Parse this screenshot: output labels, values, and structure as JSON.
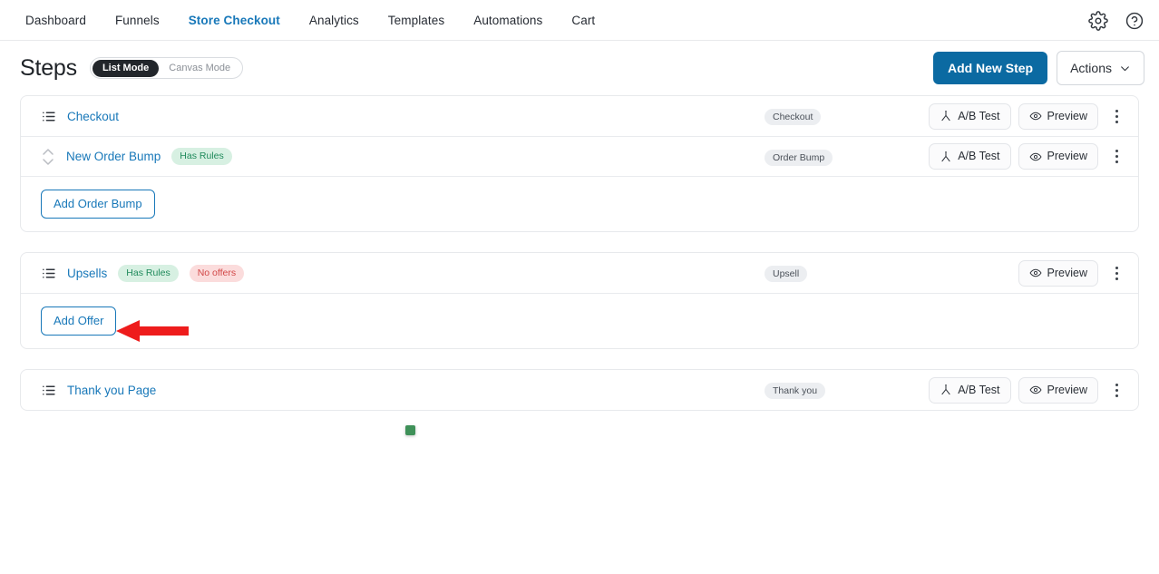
{
  "nav": {
    "items": [
      {
        "label": "Dashboard",
        "active": false
      },
      {
        "label": "Funnels",
        "active": false
      },
      {
        "label": "Store Checkout",
        "active": true
      },
      {
        "label": "Analytics",
        "active": false
      },
      {
        "label": "Templates",
        "active": false
      },
      {
        "label": "Automations",
        "active": false
      },
      {
        "label": "Cart",
        "active": false
      }
    ],
    "icons": [
      {
        "name": "gear-icon"
      },
      {
        "name": "help-circle-icon"
      }
    ]
  },
  "header": {
    "title": "Steps",
    "mode_toggle": {
      "selected": "List Mode",
      "unselected": "Canvas Mode"
    },
    "add_step_label": "Add New Step",
    "actions_label": "Actions"
  },
  "cards": [
    {
      "rows": [
        {
          "icon": "list-icon",
          "title": "Checkout",
          "badges": [],
          "type": "Checkout",
          "ab_test": "A/B Test",
          "preview": "Preview"
        },
        {
          "icon": "sort-handle-icon",
          "title": "New Order Bump",
          "badges": [
            {
              "label": "Has Rules",
              "tone": "green"
            }
          ],
          "type": "Order Bump",
          "ab_test": "A/B Test",
          "preview": "Preview"
        }
      ],
      "action_label": "Add Order Bump"
    },
    {
      "rows": [
        {
          "icon": "list-icon",
          "title": "Upsells",
          "badges": [
            {
              "label": "Has Rules",
              "tone": "green"
            },
            {
              "label": "No offers",
              "tone": "red"
            }
          ],
          "type": "Upsell",
          "ab_test": null,
          "preview": "Preview"
        }
      ],
      "action_label": "Add Offer"
    },
    {
      "rows": [
        {
          "icon": "list-icon",
          "title": "Thank you Page",
          "badges": [],
          "type": "Thank you",
          "ab_test": "A/B Test",
          "preview": "Preview"
        }
      ],
      "action_label": null
    }
  ],
  "annotation": {
    "arrow_color": "#ee1c1c",
    "arrow_points_to": "Add Offer",
    "marker_color": "#3f9159"
  }
}
